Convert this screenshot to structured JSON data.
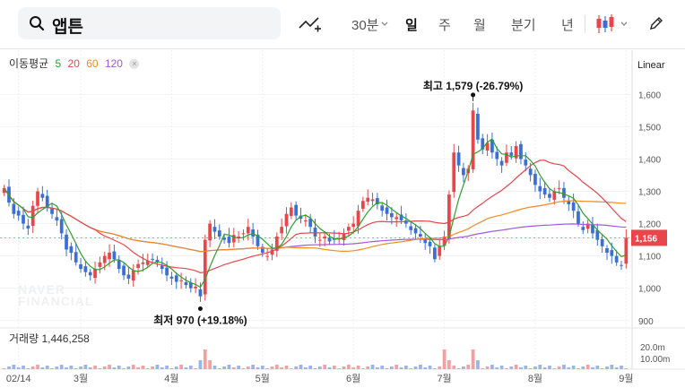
{
  "search": {
    "query": "앱튼"
  },
  "toolbar": {
    "periods": [
      "30분",
      "일",
      "주",
      "월",
      "분기",
      "년"
    ],
    "active_period": "일"
  },
  "legend": {
    "title": "이동평균",
    "ma": [
      {
        "label": "5",
        "color": "#2ca02c"
      },
      {
        "label": "20",
        "color": "#e8464a"
      },
      {
        "label": "60",
        "color": "#f08a24"
      },
      {
        "label": "120",
        "color": "#a259d9"
      }
    ]
  },
  "scale_label": "Linear",
  "volume_legend": "거래량 1,446,258",
  "watermark": [
    "NAVER",
    "FINANCIAL"
  ],
  "chart_data": {
    "type": "candlestick",
    "ylim": [
      880,
      1720
    ],
    "y_ticks": [
      "1,600",
      "1,500",
      "1,400",
      "1,300",
      "1,200",
      "1,100",
      "1,000",
      "900"
    ],
    "y_tick_values": [
      1600,
      1500,
      1400,
      1300,
      1200,
      1100,
      1000,
      900
    ],
    "x_ticks": [
      "02/14",
      "3월",
      "4월",
      "5월",
      "6월",
      "7월",
      "8월",
      "9월"
    ],
    "x_tick_index": [
      3,
      16,
      35,
      54,
      73,
      92,
      111,
      130
    ],
    "current_price": "1,156",
    "current_value": 1156,
    "annotations": {
      "high": {
        "label": "최고 1,579 (-26.79%)",
        "value": 1579,
        "index": 98
      },
      "low": {
        "label": "최저 970 (+19.18%)",
        "value": 970,
        "index": 41
      }
    },
    "volume_ticks": [
      "20.0m",
      "10.00m"
    ],
    "close": [
      1310,
      1265,
      1230,
      1225,
      1200,
      1185,
      1255,
      1300,
      1280,
      1250,
      1230,
      1210,
      1170,
      1120,
      1110,
      1080,
      1060,
      1050,
      1040,
      1060,
      1080,
      1100,
      1110,
      1090,
      1060,
      1040,
      1030,
      1055,
      1075,
      1080,
      1085,
      1090,
      1080,
      1060,
      1040,
      1030,
      1020,
      1025,
      1010,
      1000,
      1005,
      975,
      1150,
      1200,
      1175,
      1160,
      1150,
      1140,
      1165,
      1160,
      1170,
      1190,
      1160,
      1130,
      1110,
      1100,
      1120,
      1160,
      1190,
      1230,
      1250,
      1225,
      1215,
      1210,
      1190,
      1160,
      1150,
      1160,
      1145,
      1150,
      1155,
      1170,
      1190,
      1200,
      1240,
      1270,
      1280,
      1275,
      1260,
      1240,
      1230,
      1220,
      1220,
      1210,
      1200,
      1180,
      1170,
      1160,
      1140,
      1130,
      1090,
      1130,
      1160,
      1290,
      1420,
      1380,
      1350,
      1370,
      1550,
      1460,
      1430,
      1450,
      1420,
      1400,
      1380,
      1420,
      1410,
      1440,
      1400,
      1380,
      1350,
      1320,
      1300,
      1290,
      1280,
      1300,
      1310,
      1280,
      1260,
      1240,
      1200,
      1180,
      1200,
      1170,
      1150,
      1130,
      1110,
      1100,
      1080,
      1070,
      1156
    ]
  }
}
